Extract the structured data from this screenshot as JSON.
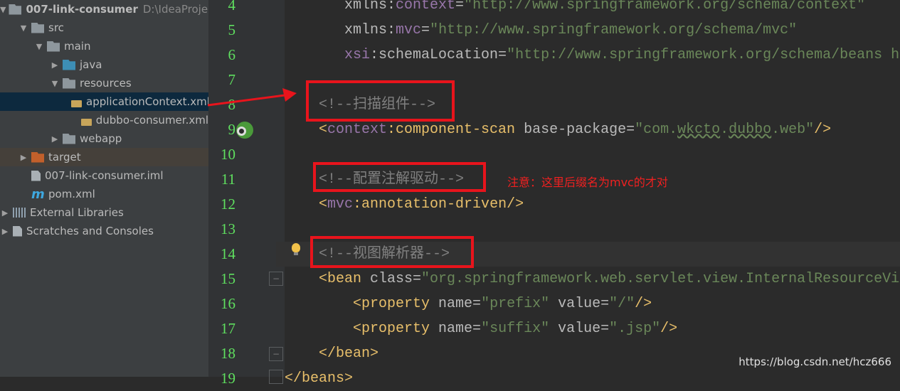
{
  "sidebar": {
    "items": [
      {
        "label": "007-link-consumer",
        "path": "D:\\IdeaProject",
        "icon": "module-folder-icon",
        "expanded": true
      },
      {
        "label": "src",
        "icon": "folder-icon",
        "expanded": true
      },
      {
        "label": "main",
        "icon": "folder-icon",
        "expanded": true
      },
      {
        "label": "java",
        "icon": "source-folder-icon",
        "expanded": false
      },
      {
        "label": "resources",
        "icon": "resources-folder-icon",
        "expanded": true
      },
      {
        "label": "applicationContext.xml",
        "icon": "spring-xml-icon",
        "selected": true
      },
      {
        "label": "dubbo-consumer.xml",
        "icon": "spring-xml-icon"
      },
      {
        "label": "webapp",
        "icon": "web-folder-icon",
        "expanded": false
      },
      {
        "label": "target",
        "icon": "excluded-folder-icon",
        "expanded": false
      },
      {
        "label": "007-link-consumer.iml",
        "icon": "iml-file-icon"
      },
      {
        "label": "pom.xml",
        "icon": "maven-icon"
      },
      {
        "label": "External Libraries",
        "icon": "libraries-icon",
        "expanded": false
      },
      {
        "label": "Scratches and Consoles",
        "icon": "scratches-icon",
        "expanded": false
      }
    ]
  },
  "editor": {
    "lines": [
      {
        "n": "4",
        "tokens": [
          [
            "attr",
            "       xmlns:"
          ],
          [
            "ns",
            "context"
          ],
          [
            "attr",
            "="
          ],
          [
            "str",
            "\"http://www.springframework.org/schema/context\""
          ]
        ]
      },
      {
        "n": "5",
        "tokens": [
          [
            "attr",
            "       xmlns:"
          ],
          [
            "ns",
            "mvc"
          ],
          [
            "attr",
            "="
          ],
          [
            "str",
            "\"http://www.springframework.org/schema/mvc\""
          ]
        ]
      },
      {
        "n": "6",
        "tokens": [
          [
            "ns",
            "       xsi"
          ],
          [
            "attr",
            ":schemaLocation="
          ],
          [
            "str",
            "\"http://www.springframework.org/schema/beans ht"
          ]
        ]
      },
      {
        "n": "7",
        "tokens": []
      },
      {
        "n": "8",
        "tokens": [
          [
            "com",
            "    <!--扫描组件-->"
          ]
        ]
      },
      {
        "n": "9",
        "tokens": [
          [
            "brk",
            "    <"
          ],
          [
            "ns",
            "context"
          ],
          [
            "tag",
            ":component-scan "
          ],
          [
            "attr",
            "base-package="
          ],
          [
            "str",
            "\"com."
          ],
          [
            "str",
            "wkcto",
            "typo"
          ],
          [
            "str",
            "."
          ],
          [
            "str",
            "dubbo",
            "typo"
          ],
          [
            "str",
            ".web\""
          ],
          [
            "brk",
            "/>"
          ]
        ]
      },
      {
        "n": "10",
        "tokens": []
      },
      {
        "n": "11",
        "tokens": [
          [
            "com",
            "    <!--配置注解驱动-->"
          ]
        ]
      },
      {
        "n": "12",
        "tokens": [
          [
            "brk",
            "    <"
          ],
          [
            "ns",
            "mvc"
          ],
          [
            "tag",
            ":annotation-driven"
          ],
          [
            "brk",
            "/>"
          ]
        ]
      },
      {
        "n": "13",
        "tokens": []
      },
      {
        "n": "14",
        "tokens": [
          [
            "com",
            "    <!--视图解析器-->"
          ]
        ]
      },
      {
        "n": "15",
        "tokens": [
          [
            "tag",
            "    <bean "
          ],
          [
            "attr",
            "class="
          ],
          [
            "str",
            "\"org.springframework.web.servlet.view.InternalResourceVie"
          ]
        ]
      },
      {
        "n": "16",
        "tokens": [
          [
            "tag",
            "        <property "
          ],
          [
            "attr",
            "name="
          ],
          [
            "str",
            "\"prefix\" "
          ],
          [
            "attr",
            "value="
          ],
          [
            "str",
            "\"/\""
          ],
          [
            "brk",
            "/>"
          ]
        ]
      },
      {
        "n": "17",
        "tokens": [
          [
            "tag",
            "        <property "
          ],
          [
            "attr",
            "name="
          ],
          [
            "str",
            "\"suffix\" "
          ],
          [
            "attr",
            "value="
          ],
          [
            "str",
            "\".jsp\""
          ],
          [
            "brk",
            "/>"
          ]
        ]
      },
      {
        "n": "18",
        "tokens": [
          [
            "tag",
            "    </bean>"
          ]
        ]
      },
      {
        "n": "19",
        "tokens": [
          [
            "tag",
            "</beans>"
          ]
        ]
      }
    ]
  },
  "annotation": {
    "note": "注意：这里后缀名为mvc的才对",
    "color": "#e8141c"
  },
  "watermark": "https://blog.csdn.net/hcz666"
}
